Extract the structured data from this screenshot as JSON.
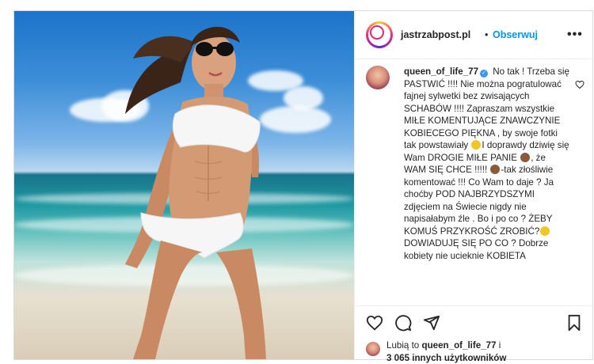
{
  "post": {
    "author": "jastrzabpost.pl",
    "separator": "•",
    "follow_label": "Obserwuj",
    "more_icon": "more-options-icon",
    "more_glyph": "•••"
  },
  "comment": {
    "username": "queen_of_life_77",
    "verified_icon": "verified-badge-icon",
    "text_1": " No tak ! Trzeba się PASTWIĆ !!!! Nie można pogratulować fajnej sylwetki bez zwisających SCHABÓW !!!! Zapraszam wszystkie MIŁE KOMENTUJĄCE ZNAWCZYNIE KOBIECEGO PIĘKNA , by swoje fotki tak powstawiały ",
    "text_2": "I doprawdy dziwię się Wam DROGIE MIŁE PANIE ",
    "text_3": ", że WAM SIĘ CHCE !!!!! ",
    "text_4": "-tak złośliwie komentować !!! Co Wam to daje ? Ja choćby POD NAJBRZYDSZYMI zdjęciem na Świecie nigdy nie napisałabym źle . Bo i po co ? ŻEBY KOMUŚ PRZYKROŚĆ ZROBIĆ?",
    "text_5": " DOWIADUJĘ SIĘ PO CO ? Dobrze kobiety nie ucieknie KOBIETA"
  },
  "actions": {
    "like_icon": "heart-icon",
    "comment_icon": "comment-icon",
    "share_icon": "share-icon",
    "save_icon": "bookmark-icon"
  },
  "likes": {
    "prefix": "Lubią to ",
    "user": "queen_of_life_77",
    "suffix": " i",
    "others": "3 065 innych użytkowników"
  },
  "colors": {
    "link_blue": "#0095f6",
    "text": "#262626",
    "border": "#dbdbdb"
  }
}
